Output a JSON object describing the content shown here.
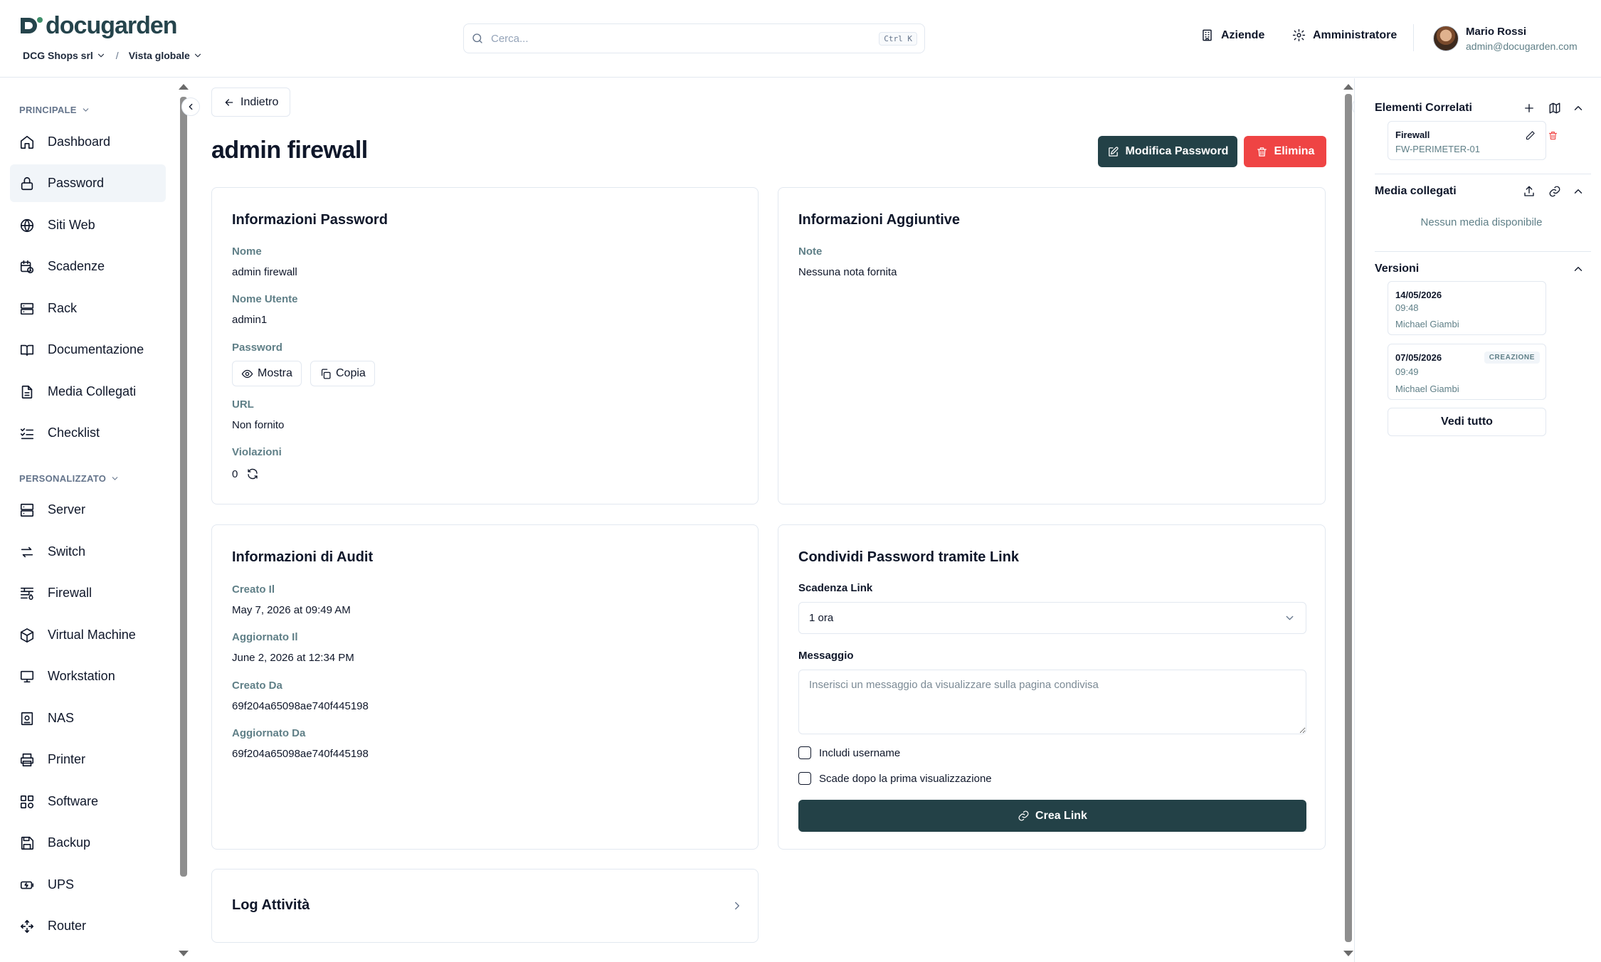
{
  "header": {
    "logo_text": "docugarden",
    "company": "DCG Shops srl",
    "view": "Vista globale",
    "search_placeholder": "Cerca...",
    "search_shortcut": "Ctrl K",
    "companies_label": "Aziende",
    "role_label": "Amministratore",
    "user_name": "Mario Rossi",
    "user_email": "admin@docugarden.com"
  },
  "sidebar": {
    "section_main": "PRINCIPALE",
    "section_custom": "PERSONALIZZATO",
    "items_main": [
      {
        "label": "Dashboard",
        "icon": "dashboard-icon"
      },
      {
        "label": "Password",
        "icon": "lock-icon",
        "active": true
      },
      {
        "label": "Siti Web",
        "icon": "globe-icon"
      },
      {
        "label": "Scadenze",
        "icon": "calendar-clock-icon"
      },
      {
        "label": "Rack",
        "icon": "rack-icon"
      },
      {
        "label": "Documentazione",
        "icon": "book-icon"
      },
      {
        "label": "Media Collegati",
        "icon": "file-icon"
      },
      {
        "label": "Checklist",
        "icon": "checklist-icon"
      }
    ],
    "items_custom": [
      {
        "label": "Server",
        "icon": "server-icon"
      },
      {
        "label": "Switch",
        "icon": "switch-icon"
      },
      {
        "label": "Firewall",
        "icon": "firewall-icon"
      },
      {
        "label": "Virtual Machine",
        "icon": "box-icon"
      },
      {
        "label": "Workstation",
        "icon": "monitor-icon"
      },
      {
        "label": "NAS",
        "icon": "nas-icon"
      },
      {
        "label": "Printer",
        "icon": "printer-icon"
      },
      {
        "label": "Software",
        "icon": "software-icon"
      },
      {
        "label": "Backup",
        "icon": "save-icon"
      },
      {
        "label": "UPS",
        "icon": "ups-icon"
      },
      {
        "label": "Router",
        "icon": "router-icon"
      }
    ]
  },
  "main": {
    "back_label": "Indietro",
    "title": "admin firewall",
    "edit_label": "Modifica Password",
    "delete_label": "Elimina",
    "password_card": {
      "title": "Informazioni Password",
      "name_label": "Nome",
      "name_value": "admin firewall",
      "username_label": "Nome Utente",
      "username_value": "admin1",
      "password_label": "Password",
      "show_label": "Mostra",
      "copy_label": "Copia",
      "url_label": "URL",
      "url_value": "Non fornito",
      "violations_label": "Violazioni",
      "violations_value": "0"
    },
    "extra_card": {
      "title": "Informazioni Aggiuntive",
      "notes_label": "Note",
      "notes_value": "Nessuna nota fornita"
    },
    "audit_card": {
      "title": "Informazioni di Audit",
      "created_label": "Creato Il",
      "created_value": "May 7, 2026 at 09:49 AM",
      "updated_label": "Aggiornato Il",
      "updated_value": "June 2, 2026 at 12:34 PM",
      "created_by_label": "Creato Da",
      "created_by_value": "69f204a65098ae740f445198",
      "updated_by_label": "Aggiornato Da",
      "updated_by_value": "69f204a65098ae740f445198"
    },
    "share_card": {
      "title": "Condividi Password tramite Link",
      "expiry_label": "Scadenza Link",
      "expiry_value": "1 ora",
      "message_label": "Messaggio",
      "message_placeholder": "Inserisci un messaggio da visualizzare sulla pagina condivisa",
      "include_username": "Includi username",
      "expire_after_first": "Scade dopo la prima visualizzazione",
      "create_link": "Crea Link"
    },
    "log_card": {
      "title": "Log Attività"
    }
  },
  "right_panel": {
    "related_title": "Elementi Correlati",
    "related_item": {
      "type": "Firewall",
      "name": "FW-PERIMETER-01"
    },
    "media_title": "Media collegati",
    "media_empty": "Nessun media disponibile",
    "versions_title": "Versioni",
    "versions": [
      {
        "date": "14/05/2026",
        "time": "09:48",
        "author": "Michael Giambi",
        "badge": ""
      },
      {
        "date": "07/05/2026",
        "time": "09:49",
        "author": "Michael Giambi",
        "badge": "CREAZIONE"
      }
    ],
    "see_all": "Vedi tutto"
  },
  "colors": {
    "brand": "#234147",
    "danger": "#ef4444",
    "muted_label": "#5f7f87"
  }
}
